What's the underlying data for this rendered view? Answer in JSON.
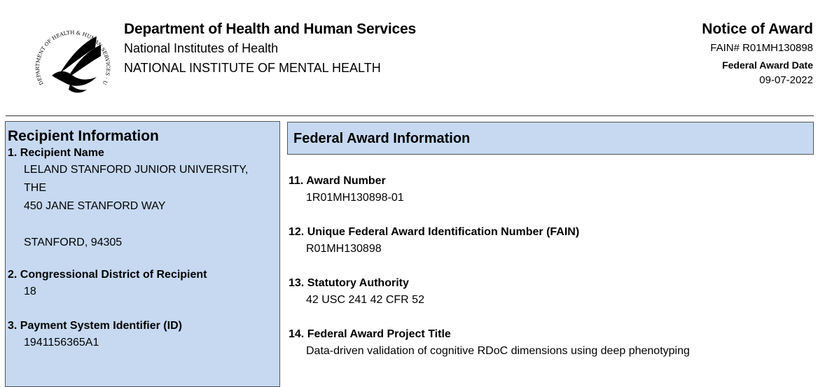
{
  "header": {
    "seal_text": "DEPARTMENT OF HEALTH & HUMAN SERVICES · USA",
    "department": "Department of Health and Human Services",
    "institutes": "National Institutes of Health",
    "institute": "NATIONAL INSTITUTE OF MENTAL HEALTH",
    "notice_title": "Notice of Award",
    "fain": "FAIN# R01MH130898",
    "award_date_label": "Federal Award Date",
    "award_date": "09-07-2022"
  },
  "recipient": {
    "heading": "Recipient Information",
    "name_label": "1. Recipient Name",
    "name_lines": [
      "LELAND STANFORD JUNIOR UNIVERSITY,",
      "THE",
      "450 JANE STANFORD WAY",
      "",
      "STANFORD, 94305"
    ],
    "district_label": "2. Congressional District of Recipient",
    "district": "18",
    "payment_label": "3. Payment System Identifier (ID)",
    "payment_id": "1941156365A1"
  },
  "federal": {
    "heading": "Federal Award Information",
    "items": [
      {
        "label": "11. Award Number",
        "value": "1R01MH130898-01"
      },
      {
        "label": "12. Unique Federal Award Identification Number (FAIN)",
        "value": "R01MH130898"
      },
      {
        "label": "13. Statutory Authority",
        "value": "42 USC 241  42 CFR 52"
      },
      {
        "label": "14. Federal Award Project Title",
        "value": "Data-driven validation of cognitive RDoC dimensions using deep phenotyping"
      }
    ]
  }
}
